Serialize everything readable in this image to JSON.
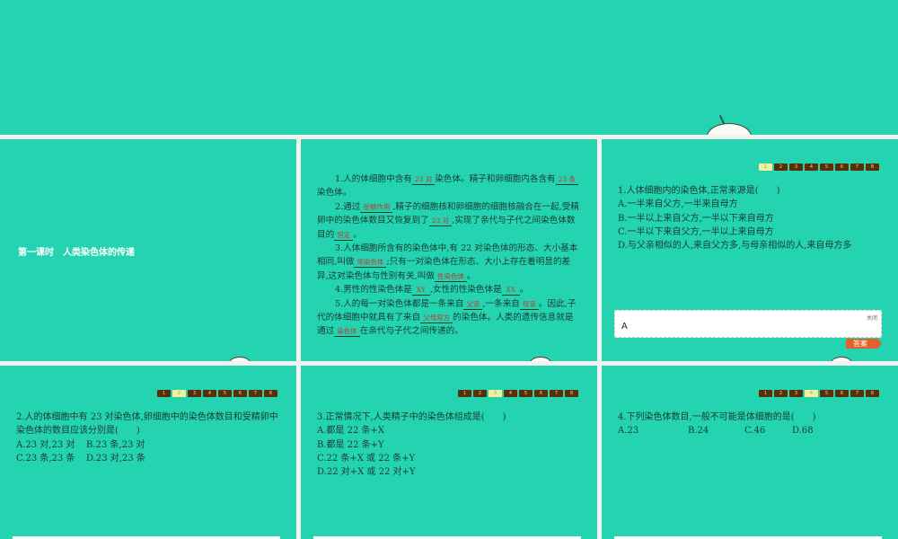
{
  "lesson_title": "第一课时　人类染色体的传递",
  "pager": [
    "1",
    "2",
    "3",
    "4",
    "5",
    "6",
    "7",
    "8"
  ],
  "notes": [
    [
      {
        "t": "1.人的体细胞中含有"
      },
      {
        "b": "23 对"
      },
      {
        "t": "染色体。精子和卵细胞内各含有"
      },
      {
        "b": "23 条"
      },
      {
        "t": "染色体。"
      }
    ],
    [
      {
        "t": "2.通过"
      },
      {
        "b": "受精作用"
      },
      {
        "t": ",精子的细胞核和卵细胞的细胞核融合在一起,受精卵中的染色体数目又恢复到了"
      },
      {
        "b": "23 对"
      },
      {
        "t": ",实现了亲代与子代之间染色体数目的"
      },
      {
        "b": "恒定"
      },
      {
        "t": "。"
      }
    ],
    [
      {
        "t": "3.人体细胞所含有的染色体中,有 22 对染色体的形态、大小基本相同,叫做"
      },
      {
        "b": "常染色体"
      },
      {
        "t": ";只有一对染色体在形态、大小上存在着明显的差异,这对染色体与性别有关,叫做"
      },
      {
        "b": "性染色体"
      },
      {
        "t": "。"
      }
    ],
    [
      {
        "t": "4.男性的性染色体是"
      },
      {
        "b": "XY"
      },
      {
        "t": ",女性的性染色体是"
      },
      {
        "b": "XX"
      },
      {
        "t": "。"
      }
    ],
    [
      {
        "t": "5.人的每一对染色体都是一条来自"
      },
      {
        "b": "父亲"
      },
      {
        "t": ",一条来自"
      },
      {
        "b": "母亲"
      },
      {
        "t": "。因此,子代的体细胞中就具有了来自"
      },
      {
        "b": "父母双方"
      },
      {
        "t": "的染色体。人类的遗传信息就是通过"
      },
      {
        "b": "染色体"
      },
      {
        "t": "在亲代与子代之间传递的。"
      }
    ]
  ],
  "questions": [
    {
      "stem": "1.人体细胞内的染色体,正常来源是(　　)",
      "options": [
        "A.一半来自父方,一半来自母方",
        "B.一半以上来自父方,一半以下来自母方",
        "C.一半以下来自父方,一半以上来自母方",
        "D.与父亲相似的人,来自父方多,与母亲相似的人,来自母方多"
      ],
      "answer": "A",
      "close": "关闭",
      "answer_btn": "答案"
    },
    {
      "stem": "2.人的体细胞中有 23 对染色体,卵细胞中的染色体数目和受精卵中染色体的数目应该分别是(　　)",
      "options": [
        "A.23 对,23 对",
        "B.23 条,23 对",
        "C.23 条,23 条",
        "D.23 对,23 条"
      ]
    },
    {
      "stem": "3.正常情况下,人类精子中的染色体组成是(　　)",
      "options": [
        "A.都是 22 条+X",
        "B.都是 22 条+Y",
        "C.22 条+X 或 22 条+Y",
        "D.22 对+X 或 22 对+Y"
      ]
    },
    {
      "stem": "4.下列染色体数目,一般不可能是体细胞的是(　　)",
      "options": [
        "A.23",
        "B.24",
        "C.46",
        "D.68"
      ]
    }
  ]
}
